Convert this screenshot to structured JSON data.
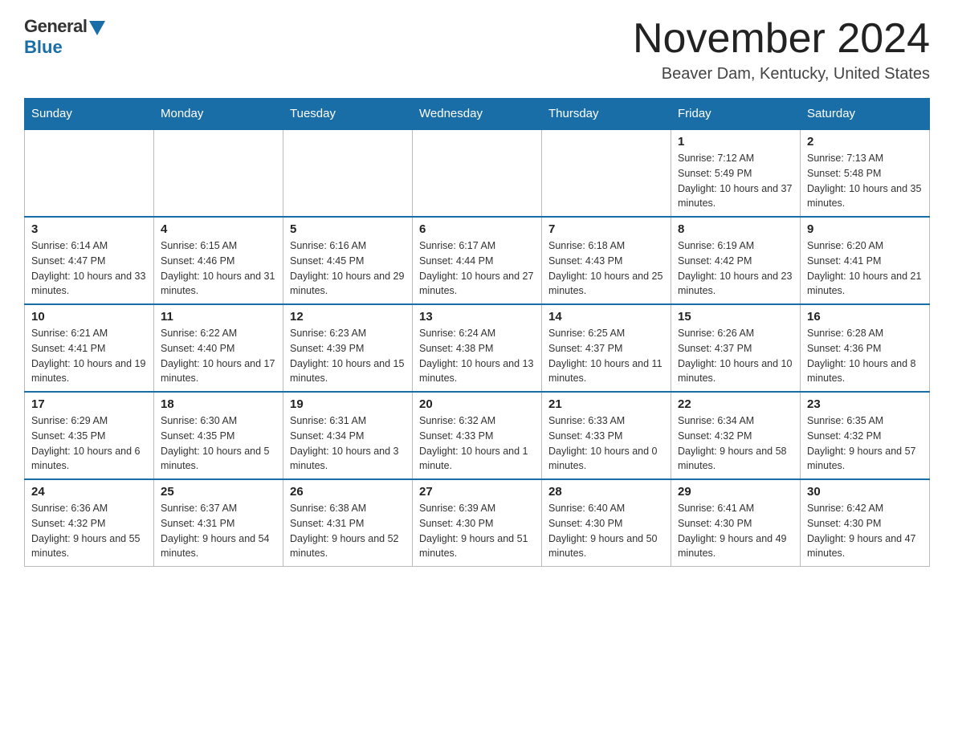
{
  "logo": {
    "general": "General",
    "blue": "Blue"
  },
  "title": "November 2024",
  "location": "Beaver Dam, Kentucky, United States",
  "days_of_week": [
    "Sunday",
    "Monday",
    "Tuesday",
    "Wednesday",
    "Thursday",
    "Friday",
    "Saturday"
  ],
  "weeks": [
    [
      {
        "day": "",
        "info": ""
      },
      {
        "day": "",
        "info": ""
      },
      {
        "day": "",
        "info": ""
      },
      {
        "day": "",
        "info": ""
      },
      {
        "day": "",
        "info": ""
      },
      {
        "day": "1",
        "info": "Sunrise: 7:12 AM\nSunset: 5:49 PM\nDaylight: 10 hours and 37 minutes."
      },
      {
        "day": "2",
        "info": "Sunrise: 7:13 AM\nSunset: 5:48 PM\nDaylight: 10 hours and 35 minutes."
      }
    ],
    [
      {
        "day": "3",
        "info": "Sunrise: 6:14 AM\nSunset: 4:47 PM\nDaylight: 10 hours and 33 minutes."
      },
      {
        "day": "4",
        "info": "Sunrise: 6:15 AM\nSunset: 4:46 PM\nDaylight: 10 hours and 31 minutes."
      },
      {
        "day": "5",
        "info": "Sunrise: 6:16 AM\nSunset: 4:45 PM\nDaylight: 10 hours and 29 minutes."
      },
      {
        "day": "6",
        "info": "Sunrise: 6:17 AM\nSunset: 4:44 PM\nDaylight: 10 hours and 27 minutes."
      },
      {
        "day": "7",
        "info": "Sunrise: 6:18 AM\nSunset: 4:43 PM\nDaylight: 10 hours and 25 minutes."
      },
      {
        "day": "8",
        "info": "Sunrise: 6:19 AM\nSunset: 4:42 PM\nDaylight: 10 hours and 23 minutes."
      },
      {
        "day": "9",
        "info": "Sunrise: 6:20 AM\nSunset: 4:41 PM\nDaylight: 10 hours and 21 minutes."
      }
    ],
    [
      {
        "day": "10",
        "info": "Sunrise: 6:21 AM\nSunset: 4:41 PM\nDaylight: 10 hours and 19 minutes."
      },
      {
        "day": "11",
        "info": "Sunrise: 6:22 AM\nSunset: 4:40 PM\nDaylight: 10 hours and 17 minutes."
      },
      {
        "day": "12",
        "info": "Sunrise: 6:23 AM\nSunset: 4:39 PM\nDaylight: 10 hours and 15 minutes."
      },
      {
        "day": "13",
        "info": "Sunrise: 6:24 AM\nSunset: 4:38 PM\nDaylight: 10 hours and 13 minutes."
      },
      {
        "day": "14",
        "info": "Sunrise: 6:25 AM\nSunset: 4:37 PM\nDaylight: 10 hours and 11 minutes."
      },
      {
        "day": "15",
        "info": "Sunrise: 6:26 AM\nSunset: 4:37 PM\nDaylight: 10 hours and 10 minutes."
      },
      {
        "day": "16",
        "info": "Sunrise: 6:28 AM\nSunset: 4:36 PM\nDaylight: 10 hours and 8 minutes."
      }
    ],
    [
      {
        "day": "17",
        "info": "Sunrise: 6:29 AM\nSunset: 4:35 PM\nDaylight: 10 hours and 6 minutes."
      },
      {
        "day": "18",
        "info": "Sunrise: 6:30 AM\nSunset: 4:35 PM\nDaylight: 10 hours and 5 minutes."
      },
      {
        "day": "19",
        "info": "Sunrise: 6:31 AM\nSunset: 4:34 PM\nDaylight: 10 hours and 3 minutes."
      },
      {
        "day": "20",
        "info": "Sunrise: 6:32 AM\nSunset: 4:33 PM\nDaylight: 10 hours and 1 minute."
      },
      {
        "day": "21",
        "info": "Sunrise: 6:33 AM\nSunset: 4:33 PM\nDaylight: 10 hours and 0 minutes."
      },
      {
        "day": "22",
        "info": "Sunrise: 6:34 AM\nSunset: 4:32 PM\nDaylight: 9 hours and 58 minutes."
      },
      {
        "day": "23",
        "info": "Sunrise: 6:35 AM\nSunset: 4:32 PM\nDaylight: 9 hours and 57 minutes."
      }
    ],
    [
      {
        "day": "24",
        "info": "Sunrise: 6:36 AM\nSunset: 4:32 PM\nDaylight: 9 hours and 55 minutes."
      },
      {
        "day": "25",
        "info": "Sunrise: 6:37 AM\nSunset: 4:31 PM\nDaylight: 9 hours and 54 minutes."
      },
      {
        "day": "26",
        "info": "Sunrise: 6:38 AM\nSunset: 4:31 PM\nDaylight: 9 hours and 52 minutes."
      },
      {
        "day": "27",
        "info": "Sunrise: 6:39 AM\nSunset: 4:30 PM\nDaylight: 9 hours and 51 minutes."
      },
      {
        "day": "28",
        "info": "Sunrise: 6:40 AM\nSunset: 4:30 PM\nDaylight: 9 hours and 50 minutes."
      },
      {
        "day": "29",
        "info": "Sunrise: 6:41 AM\nSunset: 4:30 PM\nDaylight: 9 hours and 49 minutes."
      },
      {
        "day": "30",
        "info": "Sunrise: 6:42 AM\nSunset: 4:30 PM\nDaylight: 9 hours and 47 minutes."
      }
    ]
  ]
}
